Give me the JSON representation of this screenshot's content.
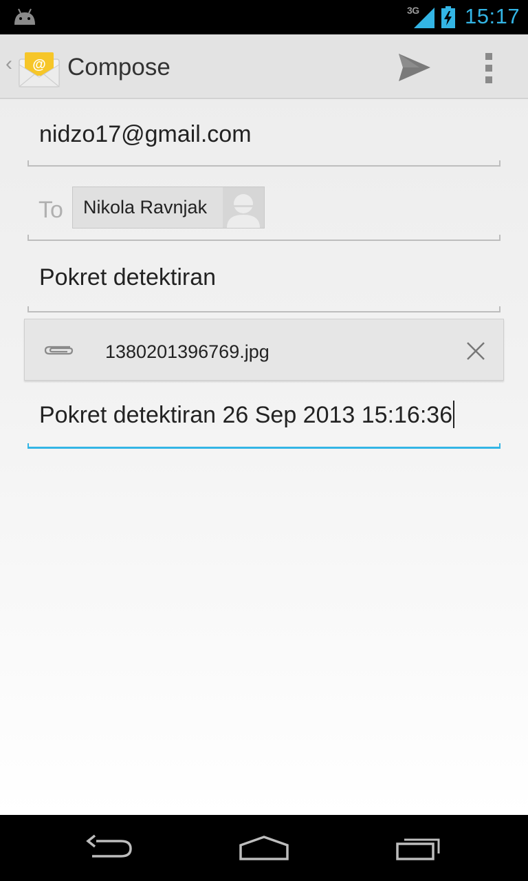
{
  "status_bar": {
    "network": "3G",
    "time": "15:17",
    "accent_color": "#33b5e5",
    "icons": [
      "android-debug-icon",
      "signal-icon",
      "battery-charging-icon"
    ]
  },
  "action_bar": {
    "title": "Compose",
    "icons": [
      "up-caret-icon",
      "email-app-icon",
      "send-icon",
      "overflow-menu-icon"
    ]
  },
  "compose": {
    "from": "nidzo17@gmail.com",
    "to_label": "To",
    "recipients": [
      {
        "name": "Nikola Ravnjak",
        "avatar": "default-contact-icon"
      }
    ],
    "subject": "Pokret detektiran",
    "attachment": {
      "filename": "1380201396769.jpg",
      "icon": "paperclip-icon",
      "remove_icon": "close-icon"
    },
    "body": "Pokret detektiran 26 Sep 2013 15:16:36"
  },
  "nav_bar": {
    "buttons": [
      "back-icon",
      "home-icon",
      "recents-icon"
    ]
  }
}
